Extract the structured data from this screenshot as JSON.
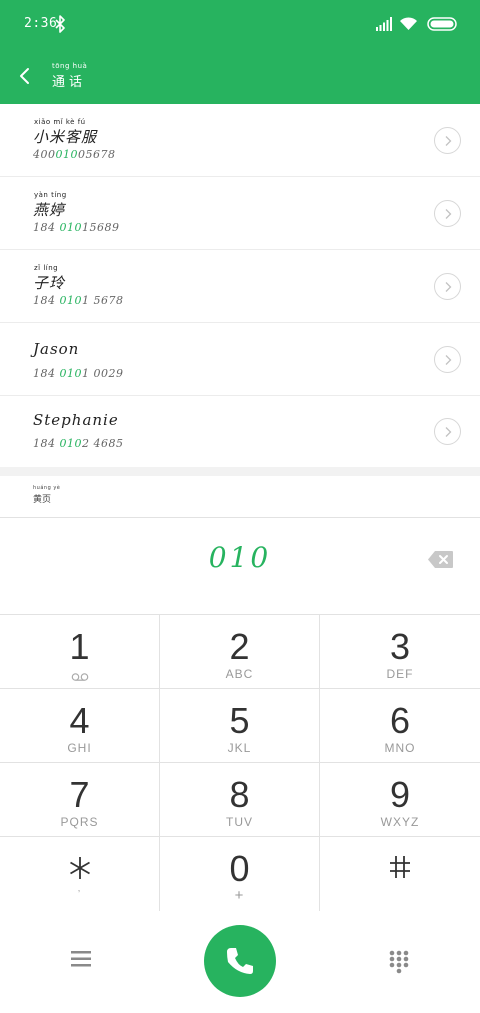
{
  "status_bar": {
    "time": "2:36"
  },
  "header": {
    "title": "通话",
    "title_pinyin": "tōng huà"
  },
  "contacts": [
    {
      "name": "小米客服",
      "name_pinyin": "xiǎo  mǐ   kè   fú",
      "number_pre": "400",
      "number_match": "010",
      "number_post": "05678"
    },
    {
      "name": "燕婷",
      "name_pinyin": "yàn  tíng",
      "number_pre": "184 ",
      "number_match": "010",
      "number_post": "15689"
    },
    {
      "name": "子玲",
      "name_pinyin": "zǐ   líng",
      "number_pre": "184 ",
      "number_match": "010",
      "number_post": "1 5678"
    },
    {
      "name": "Jason",
      "name_pinyin": "",
      "number_pre": "184 ",
      "number_match": "010",
      "number_post": "1 0029"
    },
    {
      "name": "Stephanie",
      "name_pinyin": "",
      "number_pre": "184 ",
      "number_match": "010",
      "number_post": "2 4685"
    }
  ],
  "more_hint": {
    "text": "黄页",
    "pinyin": "huáng  yè"
  },
  "dial": {
    "input": "010"
  },
  "keypad": {
    "keys": [
      {
        "digit": "1",
        "letters": ""
      },
      {
        "digit": "2",
        "letters": "ABC"
      },
      {
        "digit": "3",
        "letters": "DEF"
      },
      {
        "digit": "4",
        "letters": "GHI"
      },
      {
        "digit": "5",
        "letters": "JKL"
      },
      {
        "digit": "6",
        "letters": "MNO"
      },
      {
        "digit": "7",
        "letters": "PQRS"
      },
      {
        "digit": "8",
        "letters": "TUV"
      },
      {
        "digit": "9",
        "letters": "WXYZ"
      },
      {
        "digit": "*",
        "letters": ""
      },
      {
        "digit": "0",
        "letters": "+"
      },
      {
        "digit": "#",
        "letters": ""
      }
    ]
  },
  "icons": {
    "back": "chevron-left-icon",
    "bluetooth": "bluetooth-icon",
    "signal": "signal-icon",
    "wifi": "wifi-icon",
    "battery": "battery-icon",
    "detail": "chevron-right-icon",
    "backspace": "backspace-icon",
    "voicemail": "voicemail-icon",
    "menu": "menu-icon",
    "call": "phone-icon",
    "dialpad": "dialpad-icon"
  },
  "colors": {
    "accent": "#27b35f",
    "text": "#222222",
    "muted": "#999999"
  }
}
